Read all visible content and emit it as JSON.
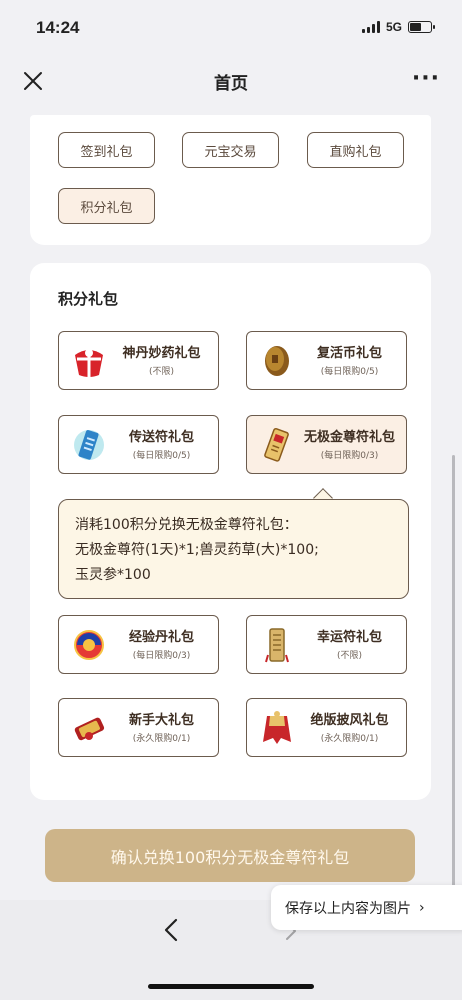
{
  "status_bar": {
    "time": "14:24",
    "network": "5G"
  },
  "nav": {
    "title": "首页",
    "more": "···"
  },
  "tabs": [
    {
      "label": "签到礼包"
    },
    {
      "label": "元宝交易"
    },
    {
      "label": "直购礼包"
    },
    {
      "label": "积分礼包",
      "active": true
    }
  ],
  "section": {
    "title": "积分礼包"
  },
  "items": [
    {
      "name": "神丹妙药礼包",
      "limit": "(不限)",
      "icon": "red-gift-bag-icon"
    },
    {
      "name": "复活币礼包",
      "limit": "(每日限购0/5)",
      "icon": "bronze-coin-icon"
    },
    {
      "name": "传送符礼包",
      "limit": "(每日限购0/5)",
      "icon": "blue-talisman-icon"
    },
    {
      "name": "无极金尊符礼包",
      "limit": "(每日限购0/3)",
      "icon": "gold-talisman-icon",
      "selected": true
    },
    {
      "name": "经验丹礼包",
      "limit": "(每日限购0/3)",
      "icon": "experience-pill-icon"
    },
    {
      "name": "幸运符礼包",
      "limit": "(不限)",
      "icon": "luck-talisman-icon"
    },
    {
      "name": "新手大礼包",
      "limit": "(永久限购0/1)",
      "icon": "newbie-scroll-icon"
    },
    {
      "name": "绝版披风礼包",
      "limit": "(永久限购0/1)",
      "icon": "cape-icon"
    }
  ],
  "tooltip": {
    "line1": "消耗100积分兑换无极金尊符礼包：",
    "line2": "无极金尊符(1天)*1;兽灵药草(大)*100;",
    "line3": "玉灵参*100"
  },
  "confirm_button": {
    "label": "确认兑换100积分无极金尊符礼包"
  },
  "save_pill": {
    "label": "保存以上内容为图片",
    "chevron": "›"
  },
  "colors": {
    "accent": "#cdb489",
    "border": "#6b5b4d",
    "selected_bg": "#fbefe4",
    "tooltip_bg": "#fdf6e6"
  }
}
